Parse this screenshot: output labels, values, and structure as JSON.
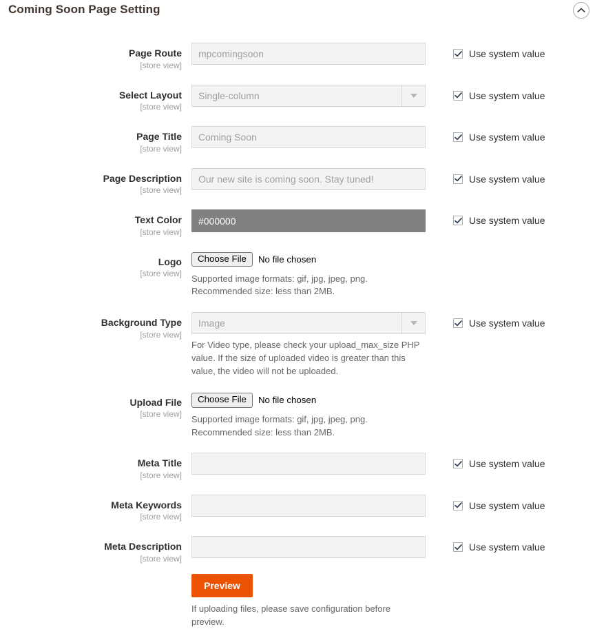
{
  "header": {
    "title": "Coming Soon Page Setting",
    "collapse_icon": "chevron-up-circle-icon"
  },
  "common": {
    "scope": "[store view]",
    "use_system_value": "Use system value",
    "choose_file": "Choose File",
    "no_file_chosen": "No file chosen",
    "image_note_line1": "Supported image formats: gif, jpg, jpeg, png.",
    "image_note_line2": "Recommended size: less than 2MB.",
    "accent_color": "#eb5202",
    "color_swatch": "#808080"
  },
  "fields": {
    "page_route": {
      "label": "Page Route",
      "value": "mpcomingsoon",
      "placeholder": "mpcomingsoon"
    },
    "select_layout": {
      "label": "Select Layout",
      "value": "Single-column"
    },
    "page_title": {
      "label": "Page Title",
      "value": "Coming Soon",
      "placeholder": "Coming Soon"
    },
    "page_description": {
      "label": "Page Description",
      "value": "Our new site is coming soon. Stay tuned!",
      "placeholder": "Our new site is coming soon. Stay tuned!"
    },
    "text_color": {
      "label": "Text Color",
      "value": "#000000"
    },
    "logo": {
      "label": "Logo"
    },
    "background_type": {
      "label": "Background Type",
      "value": "Image",
      "note": "For Video type, please check your upload_max_size PHP value. If the size of uploaded video is greater than this value, the video will not be uploaded."
    },
    "upload_file": {
      "label": "Upload File"
    },
    "meta_title": {
      "label": "Meta Title",
      "value": "",
      "placeholder": ""
    },
    "meta_keywords": {
      "label": "Meta Keywords",
      "value": "",
      "placeholder": ""
    },
    "meta_description": {
      "label": "Meta Description",
      "value": "",
      "placeholder": ""
    }
  },
  "actions": {
    "preview_label": "Preview",
    "preview_note": "If uploading files, please save configuration before preview."
  }
}
